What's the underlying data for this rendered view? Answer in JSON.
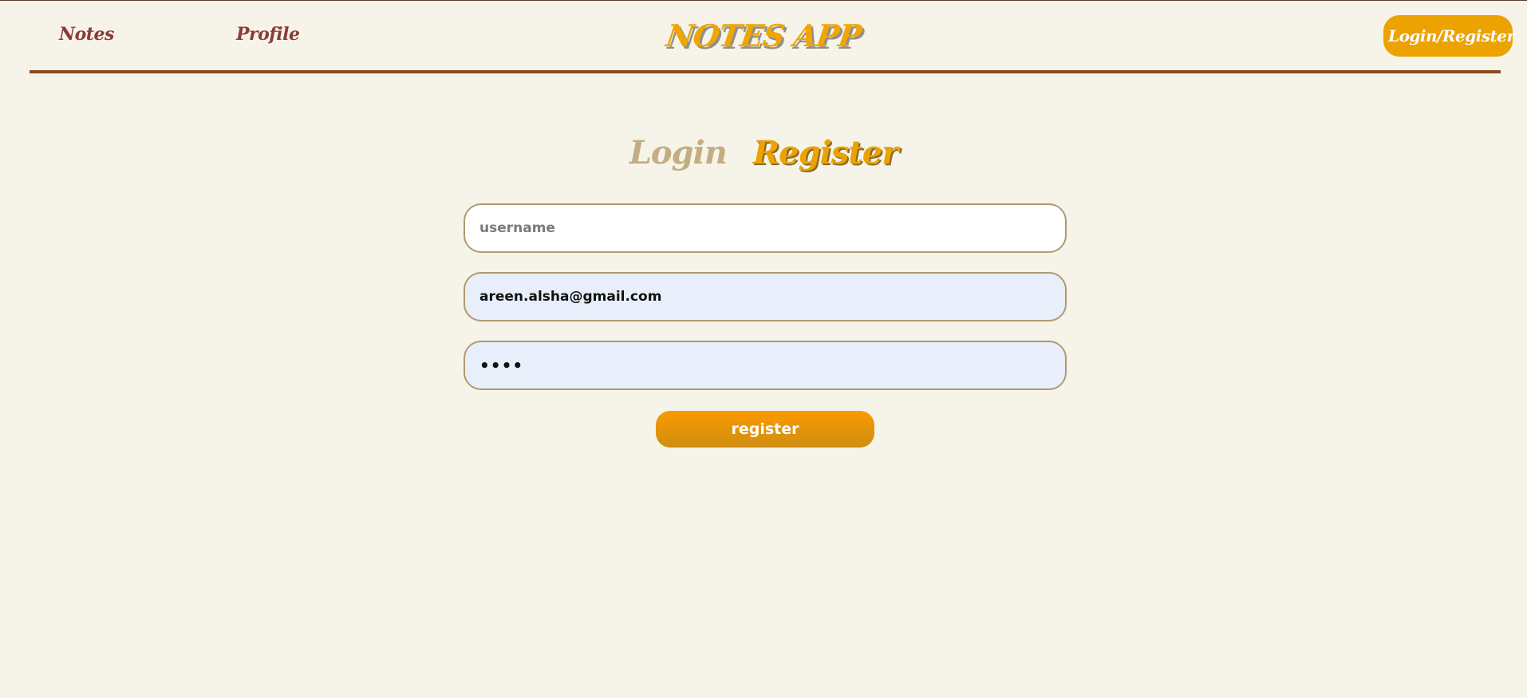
{
  "header": {
    "nav": {
      "notes_label": "Notes",
      "profile_label": "Profile"
    },
    "app_title": "NOTES APP",
    "login_register_label": "Login/Register"
  },
  "auth": {
    "tabs": {
      "login_label": "Login",
      "register_label": "Register",
      "active": "Register"
    },
    "username": {
      "placeholder": "username",
      "value": ""
    },
    "email": {
      "value": "areen.alsha@gmail.com"
    },
    "password": {
      "value": "1234"
    },
    "submit_label": "register"
  },
  "colors": {
    "background": "#f6f4e9",
    "accent": "#eca200",
    "nav_link": "#8a3b3b",
    "divider": "#8b4a22",
    "inactive_tab": "#c4ad82",
    "autofill_field": "#e8effb"
  }
}
